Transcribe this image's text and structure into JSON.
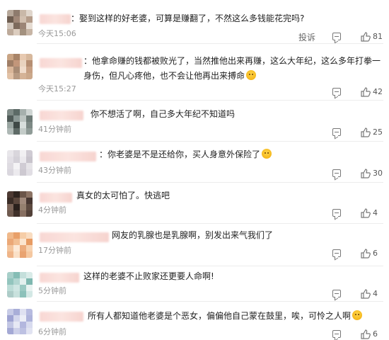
{
  "report_label": "投诉",
  "comments": [
    {
      "avatar": [
        "#b7a89a",
        "#8e7b6d",
        "#c9b8a8",
        "#e0d6cc",
        "#6e5d50",
        "#a08878",
        "#d2c0b0",
        "#b49c8a",
        "#cfc3b8",
        "#7d6a5c",
        "#9c8576",
        "#e6dcd2",
        "#bdaa9a",
        "#dccdbf",
        "#a3917f",
        "#c7b5a5"
      ],
      "text": "：娶到这样的好老婆，可算是赚翻了，不然这么多钱能花完吗?",
      "time": "今天15:06",
      "likes": "81",
      "show_report": true
    },
    {
      "avatar": [
        "#c9a484",
        "#a88468",
        "#e7c9b0",
        "#d7b89c",
        "#9f7e66",
        "#c2967a",
        "#e9d3bf",
        "#b68f73",
        "#d9b699",
        "#a88b74",
        "#f0dccb",
        "#c7a084",
        "#e2c2a6",
        "#b79a82",
        "#d5b397",
        "#cba88b"
      ],
      "text": "：他拿命赚的钱都被败光了，当然推他出来再赚，这么大年纪，这么多年打拳一身伤，但凡心疼他，也不会让他再出来搏命",
      "time": "今天15:27",
      "likes": "42",
      "show_report": false
    },
    {
      "avatar": [
        "#7e8a86",
        "#5c6a66",
        "#a6b0ad",
        "#cfd5d3",
        "#4f5a57",
        "#8a9794",
        "#bcc4c1",
        "#6e7b77",
        "#99a5a1",
        "#3f4946",
        "#d8dedc",
        "#7d8985",
        "#aeb8b5",
        "#5f6b67",
        "#c4ccc9",
        "#8f9b97"
      ],
      "text": "你不想活了啊，自己多大年纪不知道吗",
      "time": "41分钟前",
      "likes": "25",
      "show_report": false
    },
    {
      "avatar": [
        "#e8e6ea",
        "#d9d6dc",
        "#f1f0f2",
        "#cfcbd3",
        "#e2dfe5",
        "#d4d1d8",
        "#ebe9ed",
        "#c8c4cc",
        "#dedbe1",
        "#f4f3f5",
        "#d0ccd4",
        "#e6e4e8",
        "#dad7de",
        "#eceaee",
        "#cdc9d1",
        "#e1dee4"
      ],
      "text": "：你老婆是不是还给你，买人身意外保险了",
      "time": "43分钟前",
      "likes": "30",
      "show_report": false
    },
    {
      "avatar": [
        "#4d3a33",
        "#2f241f",
        "#6b5549",
        "#8c7364",
        "#3a2c26",
        "#5a463c",
        "#a18a7c",
        "#463631",
        "#7a6357",
        "#2a201c",
        "#95806f",
        "#5d4a40",
        "#6f5a4f",
        "#3f302a",
        "#876f61",
        "#524038"
      ],
      "text": "真女的太可怕了。快逃吧",
      "time": "4分钟前",
      "likes": "4",
      "show_report": false
    },
    {
      "avatar": [
        "#f0b98a",
        "#e8a06a",
        "#f6cda7",
        "#f9dcc0",
        "#eba877",
        "#f2bf93",
        "#fbe5cf",
        "#e79b63",
        "#f4c59c",
        "#fde9d6",
        "#ecac7d",
        "#f7d2b0",
        "#efb589",
        "#fae0c7",
        "#e9a371",
        "#f5c8a1"
      ],
      "text": "网友的乳腺也是乳腺啊，别发出来气我们了",
      "time": "17分钟前",
      "likes": "6",
      "show_report": false
    },
    {
      "avatar": [
        "#a7cfc9",
        "#85bdb5",
        "#c4dfdb",
        "#d9ebe8",
        "#93c5be",
        "#b2d6d1",
        "#e3f0ee",
        "#7fb8b0",
        "#bcdcd7",
        "#cfe6e3",
        "#9ac9c2",
        "#e8f3f1",
        "#adccc8",
        "#c8e1dd",
        "#8cc1ba",
        "#d3e8e5"
      ],
      "text": "这样的老婆不止败家还更要人命啊!",
      "time": "5分钟前",
      "likes": "4",
      "show_report": false
    },
    {
      "avatar": [
        "#c7cbe6",
        "#a9aed8",
        "#dfe1f1",
        "#b7bbe0",
        "#9ea3d2",
        "#d3d6ec",
        "#eceef7",
        "#aeb3db",
        "#c2c6e4",
        "#e6e8f4",
        "#b3b7de",
        "#d8dbef",
        "#a4a9d5",
        "#cdd0e9",
        "#bdc1e2",
        "#e1e3f2"
      ],
      "text": "所有人都知道他老婆是个恶女，偏偏他自己蒙在鼓里，唉，可怜之人啊",
      "time": "6分钟前",
      "likes": "6",
      "show_report": false
    }
  ]
}
